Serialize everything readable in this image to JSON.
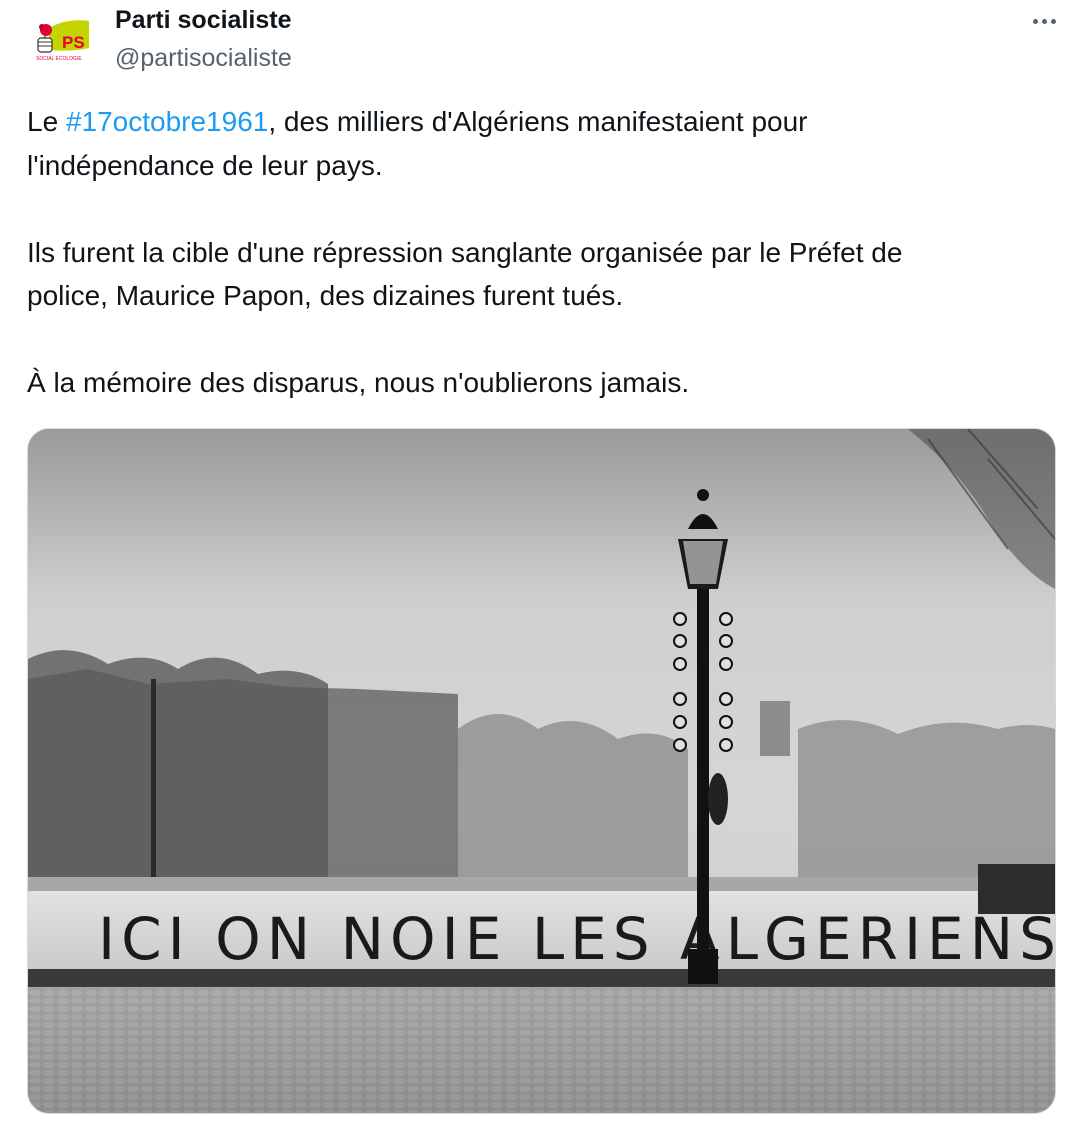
{
  "author": {
    "name": "Parti socialiste",
    "handle": "@partisocialiste",
    "avatar_icon": "ps-logo-rose-icon",
    "avatar_logo_letters": "PS",
    "avatar_logo_caption": "SOCIAL ÉCOLOGIE"
  },
  "menu": {
    "more_icon": "ellipsis-icon"
  },
  "tweet": {
    "line1_before": "Le ",
    "hashtag": "#17octobre1961",
    "line1_after": ", des milliers d'Algériens manifestaient pour",
    "line2": "l'indépendance de leur pays.",
    "paragraph2_line1": "Ils furent la cible d'une répression sanglante organisée par le Préfet de",
    "paragraph2_line2": "police, Maurice Papon, des dizaines furent tués.",
    "paragraph3": "À la mémoire des disparus, nous n'oublierons jamais."
  },
  "media": {
    "graffiti_text": "ICI ON NOIE LES ALGERIENS"
  },
  "colors": {
    "text": "#0f1419",
    "secondary": "#536471",
    "link": "#1d9bf0",
    "border": "#cfd9de",
    "ps_pink": "#e4003a",
    "ps_green": "#c3d400"
  }
}
